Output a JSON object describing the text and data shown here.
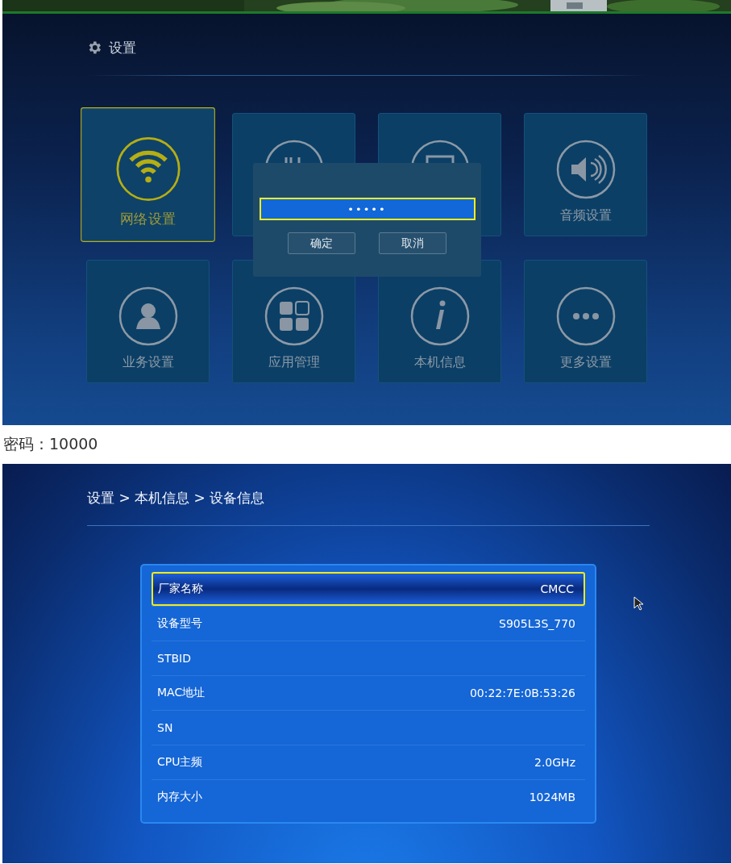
{
  "settings_screen": {
    "title": "设置",
    "tiles": [
      {
        "label": "网络设置",
        "selected": true
      },
      {
        "selected": false
      },
      {
        "selected": false
      },
      {
        "label": "音频设置",
        "selected": false
      },
      {
        "label": "业务设置",
        "selected": false
      },
      {
        "label": "应用管理",
        "selected": false
      },
      {
        "label": "本机信息",
        "selected": false
      },
      {
        "label": "更多设置",
        "selected": false
      }
    ],
    "password_dialog": {
      "value": "•••••",
      "buttons": [
        "确定",
        "取消"
      ]
    }
  },
  "caption": "密码：10000",
  "device_info_screen": {
    "breadcrumb": "设置 > 本机信息 > 设备信息",
    "rows": [
      {
        "label": "厂家名称",
        "value": "CMCC",
        "selected": true
      },
      {
        "label": "设备型号",
        "value": "S905L3S_770",
        "selected": false
      },
      {
        "label": "STBID",
        "selected": false
      },
      {
        "label": "MAC地址",
        "value": "00:22:7E:0B:53:26",
        "selected": false
      },
      {
        "label": "SN",
        "selected": false
      },
      {
        "label": "CPU主频",
        "value": "2.0GHz",
        "selected": false
      },
      {
        "label": "内存大小",
        "value": "1024MB",
        "selected": false
      }
    ]
  }
}
